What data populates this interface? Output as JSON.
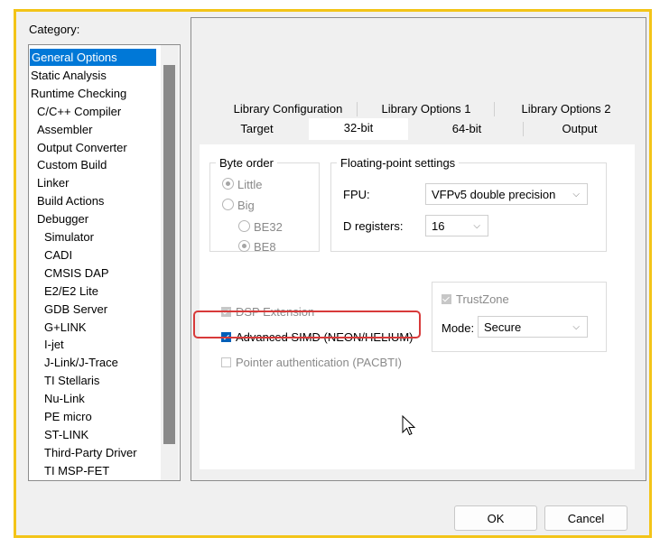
{
  "category_label": "Category:",
  "categories": [
    {
      "label": "General Options",
      "indent": 0,
      "selected": true
    },
    {
      "label": "Static Analysis",
      "indent": 0
    },
    {
      "label": "Runtime Checking",
      "indent": 0
    },
    {
      "label": "C/C++ Compiler",
      "indent": 1
    },
    {
      "label": "Assembler",
      "indent": 1
    },
    {
      "label": "Output Converter",
      "indent": 1
    },
    {
      "label": "Custom Build",
      "indent": 1
    },
    {
      "label": "Linker",
      "indent": 1
    },
    {
      "label": "Build Actions",
      "indent": 1
    },
    {
      "label": "Debugger",
      "indent": 1
    },
    {
      "label": "Simulator",
      "indent": 2
    },
    {
      "label": "CADI",
      "indent": 2
    },
    {
      "label": "CMSIS DAP",
      "indent": 2
    },
    {
      "label": "E2/E2 Lite",
      "indent": 2
    },
    {
      "label": "GDB Server",
      "indent": 2
    },
    {
      "label": "G+LINK",
      "indent": 2
    },
    {
      "label": "I-jet",
      "indent": 2
    },
    {
      "label": "J-Link/J-Trace",
      "indent": 2
    },
    {
      "label": "TI Stellaris",
      "indent": 2
    },
    {
      "label": "Nu-Link",
      "indent": 2
    },
    {
      "label": "PE micro",
      "indent": 2
    },
    {
      "label": "ST-LINK",
      "indent": 2
    },
    {
      "label": "Third-Party Driver",
      "indent": 2
    },
    {
      "label": "TI MSP-FET",
      "indent": 2
    }
  ],
  "tabs_row1": [
    "Library Configuration",
    "Library Options 1",
    "Library Options 2"
  ],
  "tabs_row2": [
    "Target",
    "32-bit",
    "64-bit",
    "Output"
  ],
  "active_tab": "32-bit",
  "byte_order": {
    "title": "Byte order",
    "little": "Little",
    "big": "Big",
    "be32": "BE32",
    "be8": "BE8"
  },
  "fp": {
    "title": "Floating-point settings",
    "fpu_label": "FPU:",
    "fpu_value": "VFPv5 double precision",
    "dreg_label": "D registers:",
    "dreg_value": "16"
  },
  "trustzone": {
    "label": "TrustZone",
    "mode_label": "Mode:",
    "mode_value": "Secure"
  },
  "checks": {
    "dsp": "DSP Extension",
    "simd": "Advanced SIMD (NEON/HELIUM)",
    "pacbti": "Pointer authentication (PACBTI)"
  },
  "buttons": {
    "ok": "OK",
    "cancel": "Cancel"
  },
  "colors": {
    "highlight_border": "#d83a3a",
    "frame": "#f3c418",
    "selection": "#0078d7"
  }
}
